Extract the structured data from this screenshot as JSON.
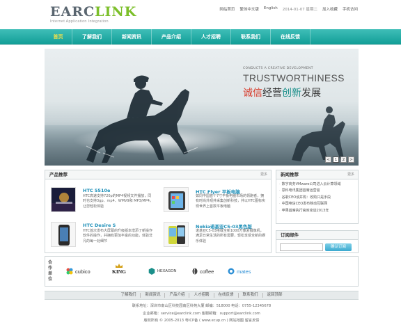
{
  "header": {
    "logo_part1": "EARC",
    "logo_part2": "LINK",
    "logo_sub": "Internet Application Integration",
    "links": [
      "网站首页",
      "繁体中文版",
      "English",
      "2014-01-07 星期二",
      "加入收藏",
      "手机访问"
    ]
  },
  "nav": {
    "items": [
      "首页",
      "了解我们",
      "新闻资讯",
      "产品介绍",
      "人才招聘",
      "联系我们",
      "在线反馈"
    ],
    "active_index": 0
  },
  "banner": {
    "tag_small": "CONDUCTS A CREATIVE DEVELOPMENT",
    "tag_en": "TRUSTWORTHINESS",
    "tag_cn_1": "诚信",
    "tag_cn_2": "经营",
    "tag_cn_3": "创新",
    "tag_cn_4": "发展",
    "pages": [
      "1",
      "2"
    ],
    "next": ">",
    "prev": "<"
  },
  "products": {
    "title": "产品推荐",
    "more": "更多",
    "items": [
      {
        "name": "HTC 5510e",
        "desc": "HTC高速支持720p的MP4视频文件播放，同时也支持3gp、mp4、WMV9和 MP3/MP4，让您轻松体验"
      },
      {
        "name": "HTC Flyer 平板电脑",
        "desc": "如同中国首个7寸平板电脑市场的领跑者，拥有时尚外观并采集创新科技，并以HTC图标实现世界上首款平板电脑"
      },
      {
        "name": "HTC Desire S",
        "desc": "HTC首次发布大屏幕的升级版本增添了新操作软件的操作，并拥有更加丰富的功能，体验非凡的每一处细节"
      },
      {
        "name": "Nokia诺基亚C5-03黑色版",
        "desc": "诺基亚C5-03搭载全新1000万像素摄像机，满足日常生活的所有需要，轻松享受全新的娱乐体验"
      }
    ]
  },
  "news": {
    "title": "新闻推荐",
    "more": "更多",
    "items": [
      "数字商务VMware公司进入云计算领域",
      "思科电讯集团首席运营官",
      "谷歌CEO谈并购：收购只是手段",
      "中国电信CEO发布移动互联网",
      "苹果首席执行官库克谈2013年"
    ]
  },
  "subscribe": {
    "title": "订阅邮件",
    "placeholder": "",
    "button": "确认订阅"
  },
  "partners": {
    "label": "合作单位",
    "items": [
      "cubico",
      "KING",
      "HEXAGON",
      "coffee",
      "mates"
    ]
  },
  "footer": {
    "links": [
      "了解我们",
      "新闻资讯",
      "产品介绍",
      "人才招聘",
      "在线反馈",
      "联系我们",
      "返回顶部"
    ],
    "line1": "联系地址：深圳市南山区科技园南区科苑大厦 邮编：518000 电话：0755-12345678",
    "line2": "企业邮箱：service@earclink.com 客服邮箱：support@earclink.com",
    "line3": "版权所有 © 2005-2013  粤ICP备 ( www.ecup.cn )  网站地图  留言反馈"
  },
  "colors": {
    "nav_teal": "#139f98",
    "nav_active": "#f3e14a",
    "logo_grey": "#5a6670",
    "logo_green": "#7cbf2a",
    "banner_accent_red": "#d73a2a",
    "banner_accent_teal": "#1b8f8a",
    "product_title": "#1d8fb8"
  }
}
